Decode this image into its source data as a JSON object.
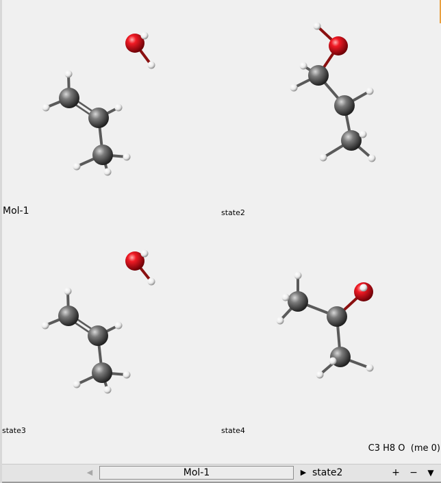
{
  "panels": [
    {
      "label": "Mol-1"
    },
    {
      "label": "state2"
    },
    {
      "label": "state3"
    },
    {
      "label": "state4"
    }
  ],
  "formula": "C3 H8 O  (me 0)",
  "bottom_bar": {
    "prev_icon": "triangle-left",
    "mol_tab": "Mol-1",
    "next_icon": "triangle-right",
    "state": "state2",
    "zoom_in": "+",
    "zoom_out": "−",
    "menu_icon": "triangle-down"
  },
  "colors": {
    "carbon": "#5a5a5a",
    "oxygen": "#e0141e",
    "hydrogen": "#f4f4f4",
    "bond": "#5a5a5a"
  }
}
